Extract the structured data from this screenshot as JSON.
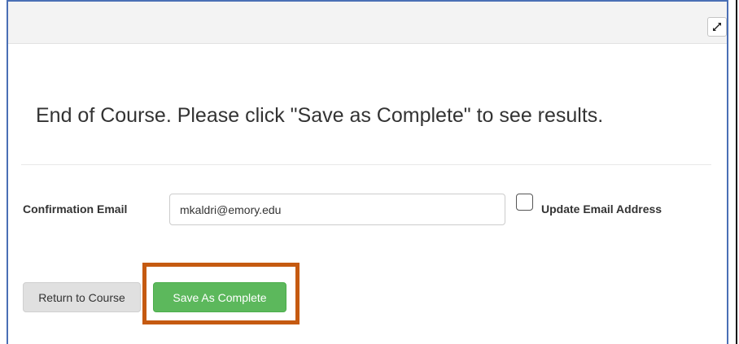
{
  "header": {
    "expand_icon": "expand-arrows-icon"
  },
  "main": {
    "heading": "End of Course. Please click \"Save as Complete\" to see results.",
    "confirmation_email_label": "Confirmation Email",
    "email_value": "mkaldri@emory.edu",
    "update_email_checked": false,
    "update_email_label": "Update Email Address"
  },
  "buttons": {
    "return_label": "Return to Course",
    "save_label": "Save As Complete"
  },
  "colors": {
    "save_button": "#5cb85c",
    "return_button": "#e0e0e0",
    "highlight_border": "#c55a11",
    "frame_border": "#4a6fb5"
  }
}
